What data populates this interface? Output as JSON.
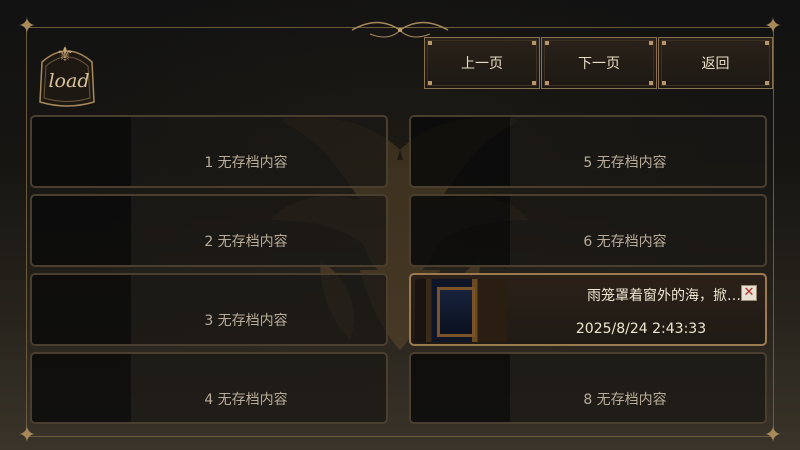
{
  "badge": {
    "text": "load"
  },
  "buttons": {
    "prev": "上一页",
    "next": "下一页",
    "back": "返回"
  },
  "slots": [
    {
      "label": "1 无存档内容"
    },
    {
      "label": "2 无存档内容"
    },
    {
      "label": "3 无存档内容"
    },
    {
      "label": "4 无存档内容"
    },
    {
      "label": "5 无存档内容"
    },
    {
      "label": "6 无存档内容"
    },
    {
      "title": "雨笼罩着窗外的海，掀…",
      "date": "2025/8/24 2:43:33"
    },
    {
      "label": "8 无存档内容"
    }
  ],
  "icons": {
    "delete": "close-x-icon",
    "badge": "fleur-de-lis-icon"
  },
  "colors": {
    "accent": "#c5a572",
    "text": "#e8dcc2"
  }
}
